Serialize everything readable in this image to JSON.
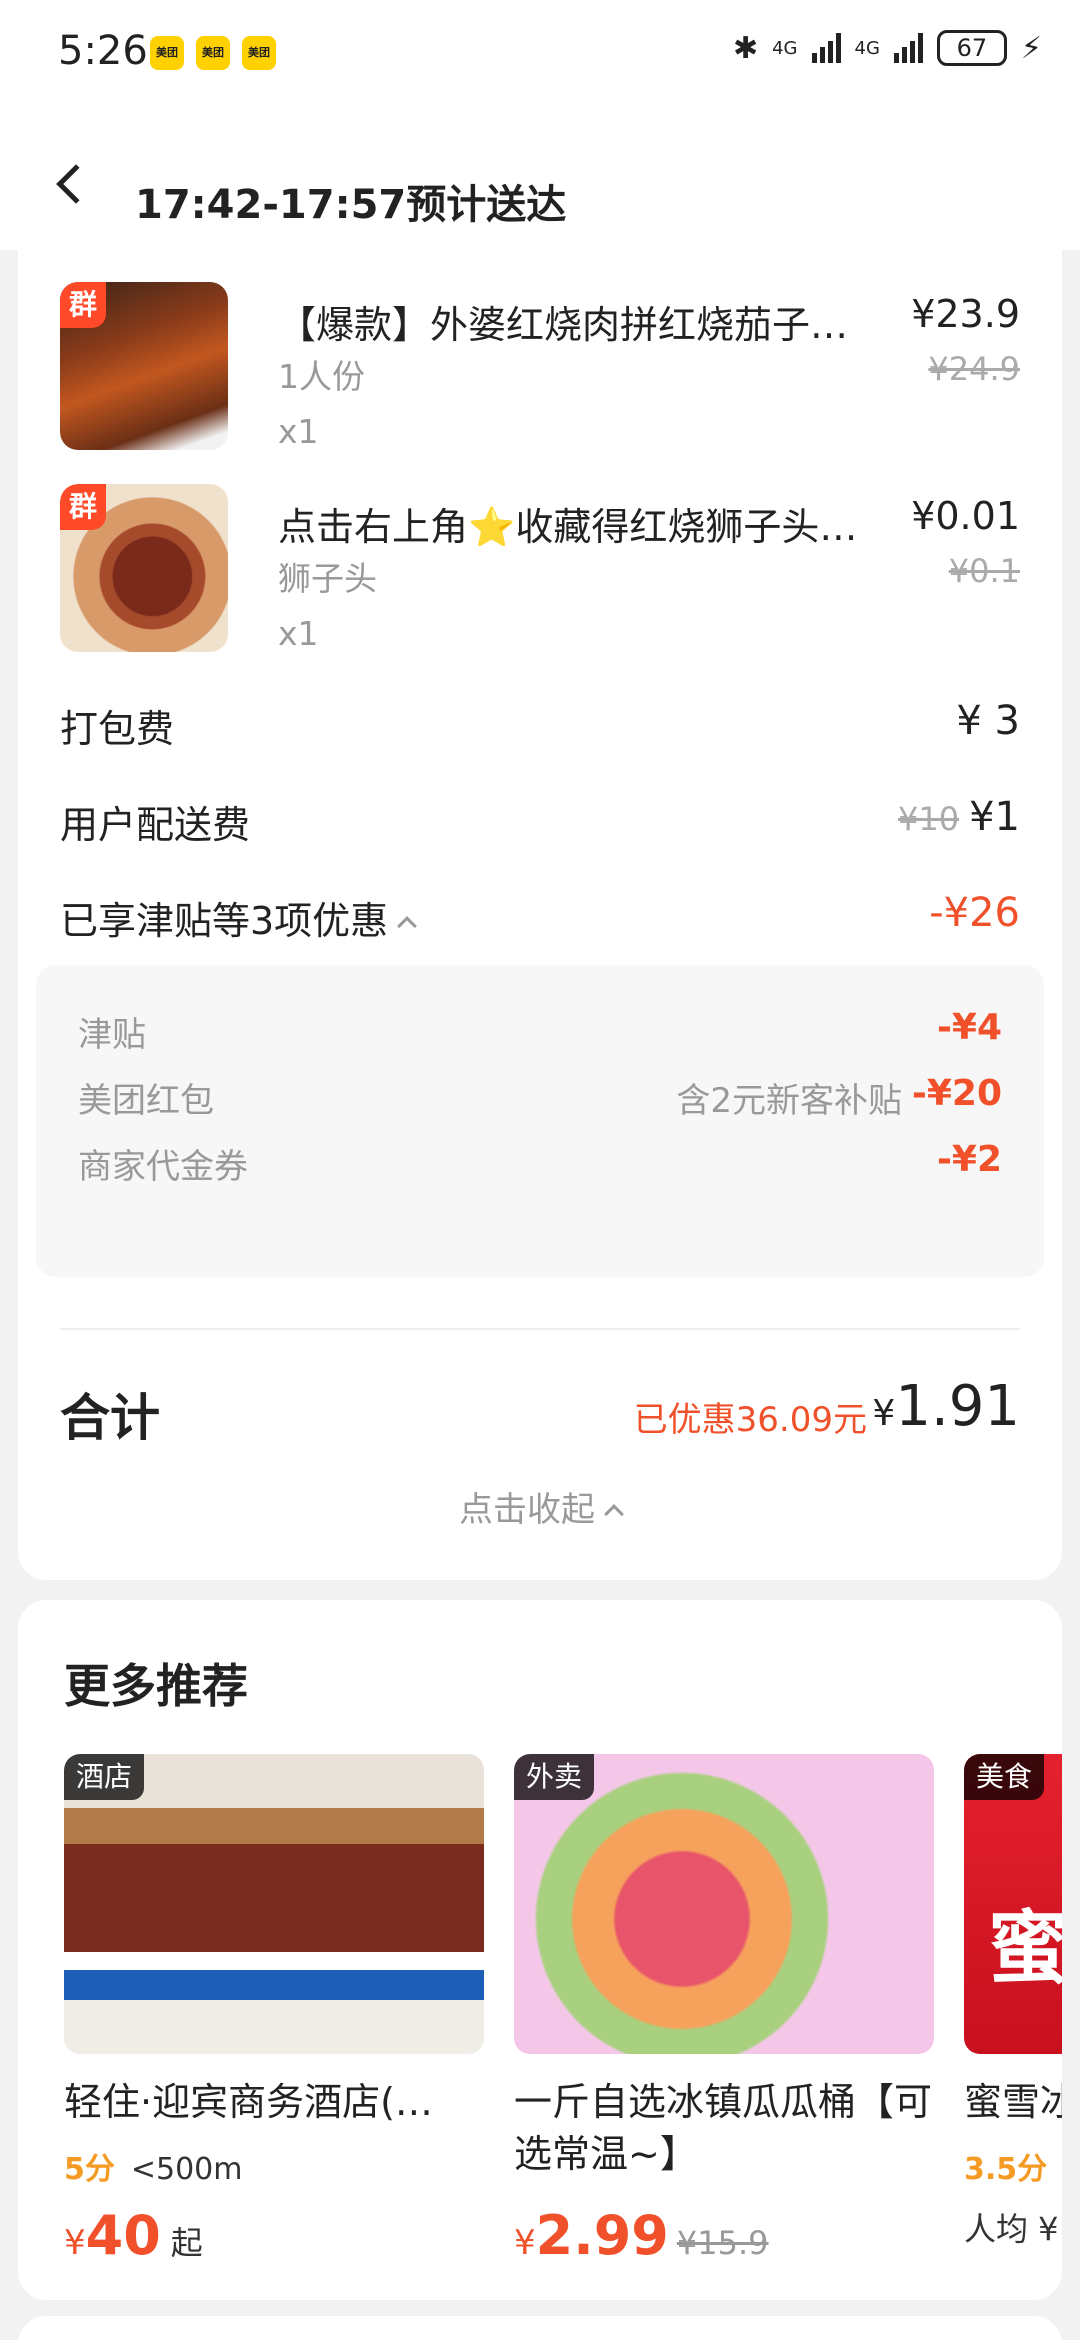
{
  "status_bar": {
    "time": "5:26",
    "net1": "4G",
    "net2": "4G",
    "battery": "67",
    "badges": [
      "美团",
      "美团",
      "美团"
    ]
  },
  "header": {
    "title": "17:42-17:57预计送达"
  },
  "items": [
    {
      "tag": "群",
      "name": "【爆款】外婆红烧肉拼红烧茄子…",
      "spec": "1人份",
      "qty": "x1",
      "price": "¥23.9",
      "orig_price": "¥24.9"
    },
    {
      "tag": "群",
      "name": "点击右上角⭐收藏得红烧狮子头…",
      "spec": "狮子头",
      "qty": "x1",
      "price": "¥0.01",
      "orig_price": "¥0.1"
    }
  ],
  "fees": {
    "packing_label": "打包费",
    "packing_value": "¥ 3",
    "delivery_label": "用户配送费",
    "delivery_orig": "¥10",
    "delivery_value": "¥1",
    "discount_summary_label": "已享津贴等3项优惠",
    "discount_summary_value": "-¥26"
  },
  "discounts": [
    {
      "label": "津贴",
      "note": "",
      "value": "-¥4"
    },
    {
      "label": "美团红包",
      "note": "含2元新客补贴",
      "value": "-¥20"
    },
    {
      "label": "商家代金券",
      "note": "",
      "value": "-¥2"
    }
  ],
  "total": {
    "label": "合计",
    "saved": "已优惠36.09元",
    "yen": "¥",
    "value": "1.91",
    "collapse": "点击收起"
  },
  "recommend": {
    "title": "更多推荐",
    "items": [
      {
        "tag": "酒店",
        "name": "轻住·迎宾商务酒店(…",
        "score": "5分",
        "distance": "<500m",
        "yen": "¥",
        "price": "40",
        "suffix": "起",
        "orig": ""
      },
      {
        "tag": "外卖",
        "name": "一斤自选冰镇瓜瓜桶【可选常温~】",
        "score": "",
        "distance": "",
        "yen": "¥",
        "price": "2.99",
        "suffix": "",
        "orig": "¥15.9"
      },
      {
        "tag": "美食",
        "name": "蜜雪冰",
        "score": "3.5分",
        "distance": "",
        "avg": "人均 ¥",
        "char": "蜜"
      }
    ]
  }
}
